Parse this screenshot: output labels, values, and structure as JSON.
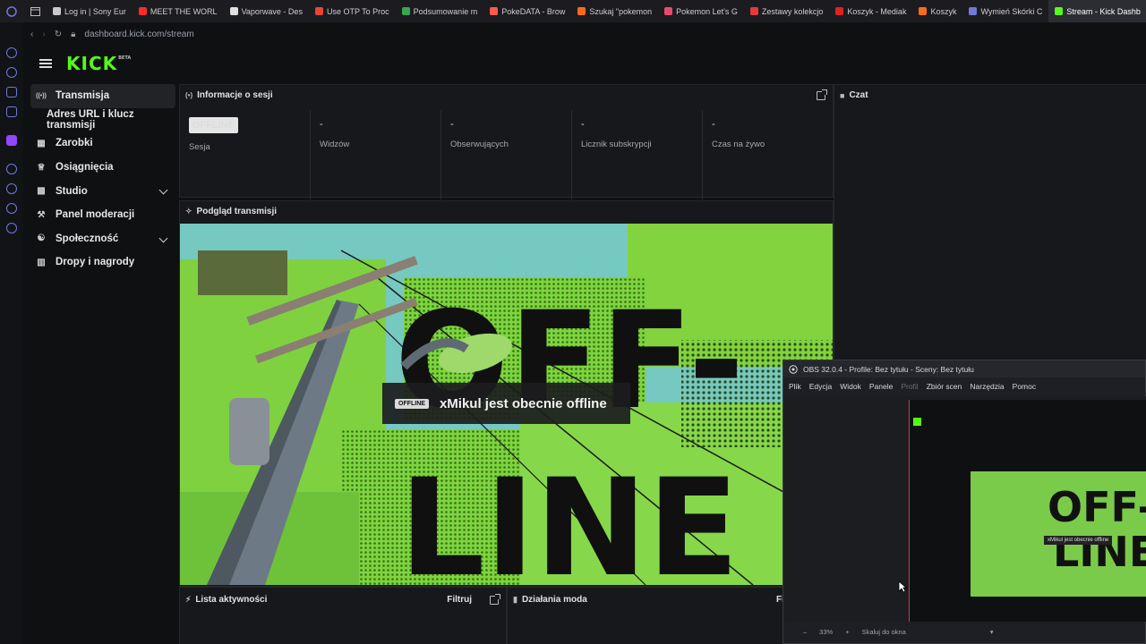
{
  "browser": {
    "tabs": [
      {
        "label": "Log in | Sony Eur",
        "color": "#c9c9c9"
      },
      {
        "label": "MEET THE WORL",
        "color": "#ff2a2a"
      },
      {
        "label": "Vaporwave - Des",
        "color": "#e0e0e0"
      },
      {
        "label": "Use OTP To Proc",
        "color": "#ea4335"
      },
      {
        "label": "Podsumowanie m",
        "color": "#34a853"
      },
      {
        "label": "PokeDATA - Brow",
        "color": "#ff5a4a"
      },
      {
        "label": "Szukaj \"pokemon",
        "color": "#ff6a1a"
      },
      {
        "label": "Pokemon Let's G",
        "color": "#e84b6a"
      },
      {
        "label": "Zestawy kolekcjo",
        "color": "#e33b3b"
      },
      {
        "label": "Koszyk - Mediak",
        "color": "#e22020"
      },
      {
        "label": "Koszyk",
        "color": "#ff6a1a"
      },
      {
        "label": "Wymień Skórki C",
        "color": "#6f79d8"
      },
      {
        "label": "Stream - Kick Dashb",
        "color": "#53fc18",
        "active": true
      }
    ],
    "url": "dashboard.kick.com/stream"
  },
  "brand": {
    "logo": "KICK",
    "tag": "BETA",
    "accent": "#53fc18"
  },
  "sidebar": {
    "items": [
      {
        "label": "Transmisja",
        "icon": "broadcast-icon",
        "active": true
      },
      {
        "label": "Adres URL i klucz transmisji",
        "sub": true
      },
      {
        "label": "Zarobki",
        "icon": "earnings-icon"
      },
      {
        "label": "Osiągnięcia",
        "icon": "trophy-icon"
      },
      {
        "label": "Studio",
        "icon": "studio-icon",
        "expandable": true
      },
      {
        "label": "Panel moderacji",
        "icon": "wrench-icon"
      },
      {
        "label": "Społeczność",
        "icon": "community-icon",
        "expandable": true
      },
      {
        "label": "Dropy i nagrody",
        "icon": "drops-icon"
      }
    ]
  },
  "session": {
    "title": "Informacje o sesji",
    "status_badge": "OFFLINE",
    "stats": [
      {
        "value": "",
        "label": "Sesja"
      },
      {
        "value": "-",
        "label": "Widzów"
      },
      {
        "value": "-",
        "label": "Obserwujących"
      },
      {
        "value": "-",
        "label": "Licznik subskrypcji"
      },
      {
        "value": "-",
        "label": "Czas na żywo"
      }
    ]
  },
  "chat": {
    "title": "Czat"
  },
  "preview": {
    "title": "Podgląd transmisji",
    "art_text_1": "OFF-",
    "art_text_2": "LINE",
    "badge": "OFFLINE",
    "message": "xMikul jest obecnie offline"
  },
  "activity": {
    "title": "Lista aktywności",
    "filter": "Filtruj"
  },
  "mod_actions": {
    "title": "Działania moda",
    "filter": "Fi"
  },
  "obs": {
    "title": "OBS 32.0.4 - Profile: Bez tytułu - Sceny: Bez tytułu",
    "menu": [
      "Plik",
      "Edycja",
      "Widok",
      "Panele",
      "Profil",
      "Zbiór scen",
      "Narzędzia",
      "Pomoc"
    ],
    "zoom": "33%",
    "scale_option": "Skaluj do okna"
  }
}
